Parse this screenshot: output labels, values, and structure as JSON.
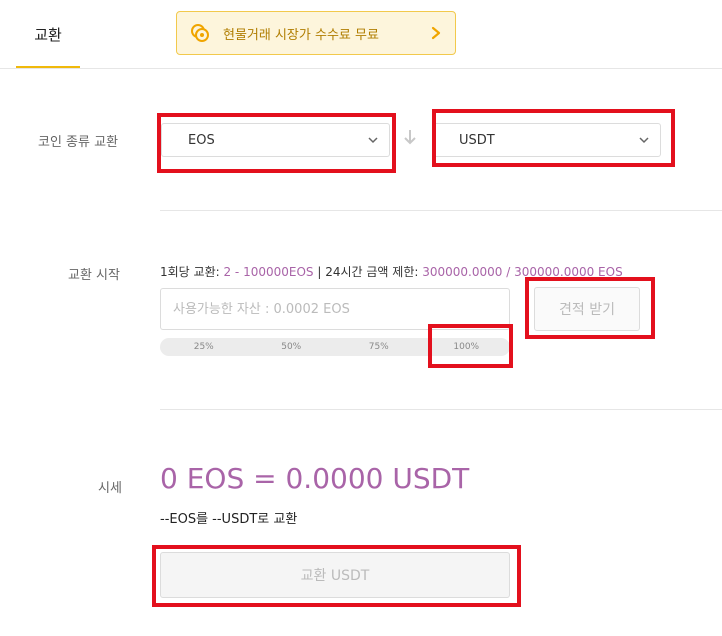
{
  "tabs": {
    "active": "교환"
  },
  "promo": {
    "text": "현물거래 시장가 수수료 무료"
  },
  "swap": {
    "label": "코인 종류 교환",
    "from_coin": "EOS",
    "to_coin": "USDT"
  },
  "start": {
    "label": "교환 시작",
    "per_trade_label": "1회당 교환:",
    "per_trade_value": "2 - 100000EOS",
    "daily_label": "| 24시간 금액 제한:",
    "daily_value": "300000.0000 / 300000.0000 EOS",
    "amount_placeholder": "사용가능한 자산 : 0.0002 EOS",
    "quote_button": "견적 받기",
    "percentages": [
      "25%",
      "50%",
      "75%",
      "100%"
    ]
  },
  "rate": {
    "label": "시세",
    "main": "0 EOS = 0.0000 USDT",
    "sub": "--EOS를 --USDT로 교환",
    "exchange_button": "교환 USDT"
  },
  "colors": {
    "accent": "#f0b90b",
    "rate_purple": "#a964a8",
    "annotation_red": "#e3101d"
  }
}
